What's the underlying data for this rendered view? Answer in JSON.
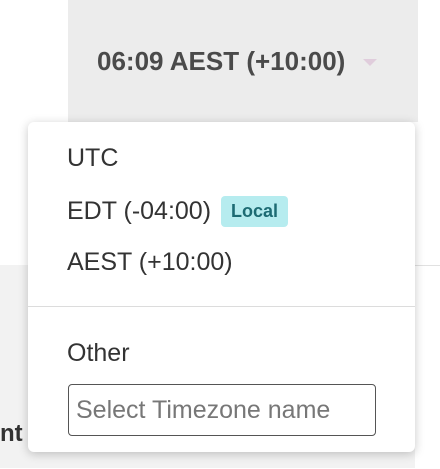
{
  "header": {
    "time_label": "06:09 AEST (+10:00)",
    "caret_icon": "caret-down-icon"
  },
  "background": {
    "partial_text": "nt '"
  },
  "dropdown": {
    "options": [
      {
        "label": "UTC"
      },
      {
        "label": "EDT (-04:00)",
        "badge": "Local"
      },
      {
        "label": "AEST (+10:00)"
      }
    ],
    "other_label": "Other",
    "input_placeholder": "Select Timezone name",
    "input_value": ""
  },
  "colors": {
    "badge_bg": "#b6ecef",
    "badge_text": "#1d6b73",
    "button_bg": "#ececec"
  }
}
